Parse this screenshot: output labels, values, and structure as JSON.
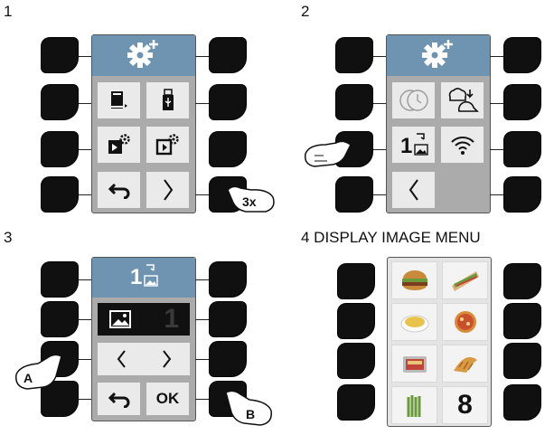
{
  "steps": [
    {
      "label": "1"
    },
    {
      "label": "2"
    },
    {
      "label": "3"
    },
    {
      "label": "4 DISPLAY IMAGE MENU"
    }
  ],
  "step1": {
    "press_count": "3x"
  },
  "step3": {
    "image_number": "1",
    "ok_label": "OK",
    "callout_a": "A",
    "callout_b": "B"
  },
  "step4": {
    "image_number": "8"
  },
  "icons": {
    "settings": "gear-plus-icon",
    "book": "book-icon",
    "usb": "usb-icon",
    "export": "export-gear-icon",
    "import": "import-gear-icon",
    "back": "back-arrow-icon",
    "next": "chevron-right-icon",
    "prev": "chevron-left-icon",
    "clock": "clock-icon",
    "chef": "chef-hat-swap-icon",
    "image_swap": "image-number-swap-icon",
    "wifi": "wifi-icon",
    "picture": "picture-icon"
  },
  "colors": {
    "header": "#6f94b2",
    "panel": "#ababab",
    "tile": "#eaeaea",
    "key": "#101010"
  }
}
